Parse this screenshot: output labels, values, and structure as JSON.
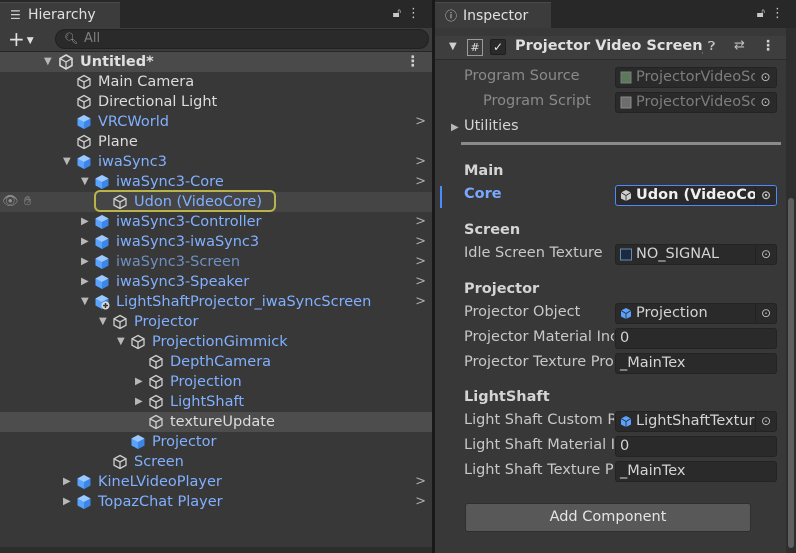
{
  "hierarchy": {
    "tab_label": "Hierarchy",
    "search_placeholder": "All",
    "scene_name": "Untitled*",
    "rows": [
      {
        "label": "Main Camera",
        "color": "white",
        "indent": 80,
        "arrow": "",
        "chev": false,
        "icon": "gameobject-icon"
      },
      {
        "label": "Directional Light",
        "color": "white",
        "indent": 80,
        "arrow": "",
        "chev": false,
        "icon": "gameobject-icon"
      },
      {
        "label": "VRCWorld",
        "color": "blue",
        "indent": 80,
        "arrow": "",
        "chev": true,
        "icon": "prefab-icon"
      },
      {
        "label": "Plane",
        "color": "white",
        "indent": 80,
        "arrow": "",
        "chev": false,
        "icon": "gameobject-icon"
      },
      {
        "label": "iwaSync3",
        "color": "blue",
        "indent": 80,
        "arrow": "down",
        "chev": true,
        "icon": "prefab-icon"
      },
      {
        "label": "iwaSync3-Core",
        "color": "blue",
        "indent": 98,
        "arrow": "down",
        "chev": true,
        "icon": "prefab-icon"
      },
      {
        "label": "Udon (VideoCore)",
        "color": "blue",
        "indent": 116,
        "arrow": "",
        "chev": false,
        "icon": "gameobject-icon",
        "selected": true
      },
      {
        "label": "iwaSync3-Controller",
        "color": "blue",
        "indent": 98,
        "arrow": "right",
        "chev": true,
        "icon": "prefab-icon"
      },
      {
        "label": "iwaSync3-iwaSync3",
        "color": "blue",
        "indent": 98,
        "arrow": "right",
        "chev": true,
        "icon": "prefab-icon"
      },
      {
        "label": "iwaSync3-Screen",
        "color": "faded",
        "indent": 98,
        "arrow": "right",
        "chev": true,
        "icon": "prefab-icon"
      },
      {
        "label": "iwaSync3-Speaker",
        "color": "blue",
        "indent": 98,
        "arrow": "right",
        "chev": true,
        "icon": "prefab-icon"
      },
      {
        "label": "LightShaftProjector_iwaSyncScreen",
        "color": "blue",
        "indent": 98,
        "arrow": "down",
        "chev": true,
        "icon": "prefab-add-icon"
      },
      {
        "label": "Projector",
        "color": "blue",
        "indent": 116,
        "arrow": "down",
        "chev": false,
        "icon": "gameobject-icon"
      },
      {
        "label": "ProjectionGimmick",
        "color": "blue",
        "indent": 134,
        "arrow": "down",
        "chev": false,
        "icon": "gameobject-icon"
      },
      {
        "label": "DepthCamera",
        "color": "blue",
        "indent": 152,
        "arrow": "",
        "chev": false,
        "icon": "gameobject-icon"
      },
      {
        "label": "Projection",
        "color": "blue",
        "indent": 152,
        "arrow": "right",
        "chev": false,
        "icon": "gameobject-icon"
      },
      {
        "label": "LightShaft",
        "color": "blue",
        "indent": 152,
        "arrow": "right",
        "chev": false,
        "icon": "gameobject-icon"
      },
      {
        "label": "textureUpdate",
        "color": "white",
        "indent": 152,
        "arrow": "",
        "chev": false,
        "icon": "gameobject-icon",
        "hover": true
      },
      {
        "label": "Projector",
        "color": "blue",
        "indent": 134,
        "arrow": "",
        "chev": false,
        "icon": "prefab-icon"
      },
      {
        "label": "Screen",
        "color": "blue",
        "indent": 116,
        "arrow": "",
        "chev": false,
        "icon": "gameobject-icon"
      },
      {
        "label": "KineLVideoPlayer",
        "color": "blue",
        "indent": 80,
        "arrow": "right",
        "chev": true,
        "icon": "prefab-icon"
      },
      {
        "label": "TopazChat Player",
        "color": "blue",
        "indent": 80,
        "arrow": "right",
        "chev": true,
        "icon": "prefab-icon"
      }
    ]
  },
  "inspector": {
    "tab_label": "Inspector",
    "component_title": "Projector Video Screen_iw",
    "component_enabled": true,
    "program_source_label": "Program Source",
    "program_source_value": "ProjectorVideoSc",
    "program_script_label": "Program Script",
    "program_script_value": "ProjectorVideoSc",
    "utilities_label": "Utilities",
    "sections": [
      {
        "title": "Main",
        "fields": [
          {
            "label": "Core",
            "value": "Udon (VideoCo",
            "kind": "object",
            "active": true
          }
        ]
      },
      {
        "title": "Screen",
        "fields": [
          {
            "label": "Idle Screen Texture",
            "value": "NO_SIGNAL",
            "kind": "texture"
          }
        ]
      },
      {
        "title": "Projector",
        "fields": [
          {
            "label": "Projector Object",
            "value": "Projection",
            "kind": "object"
          },
          {
            "label": "Projector Material Inc",
            "value": "0",
            "kind": "text"
          },
          {
            "label": "Projector Texture Pro",
            "value": "_MainTex",
            "kind": "text"
          }
        ]
      },
      {
        "title": "LightShaft",
        "fields": [
          {
            "label": "Light Shaft Custom R",
            "value": "LightShaftTextur",
            "kind": "object"
          },
          {
            "label": "Light Shaft Material I",
            "value": "0",
            "kind": "text"
          },
          {
            "label": "Light Shaft Texture P",
            "value": "_MainTex",
            "kind": "text"
          }
        ]
      }
    ],
    "add_component_label": "Add Component"
  },
  "colors": {
    "blue": "#80b0ff",
    "white": "#dcdcdc",
    "faded": "#6f8fc0",
    "accent": "#4a8bff",
    "highlight": "#b9b34a"
  }
}
